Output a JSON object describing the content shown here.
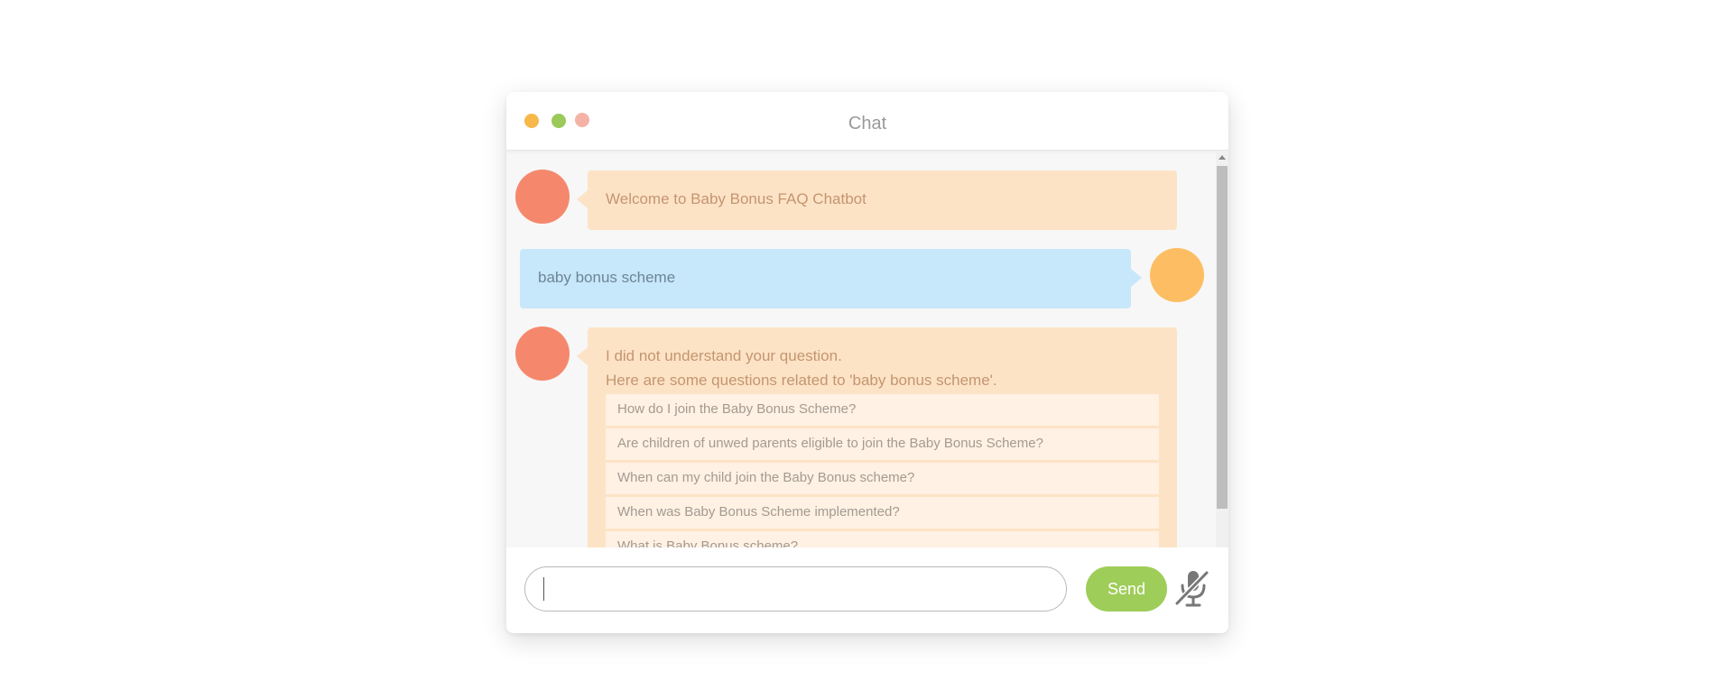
{
  "window": {
    "title": "Chat",
    "controls": [
      "minimize",
      "maximize",
      "close"
    ]
  },
  "messages": [
    {
      "sender": "bot",
      "lines": [
        "Welcome to Baby Bonus FAQ Chatbot"
      ]
    },
    {
      "sender": "user",
      "lines": [
        "baby bonus scheme"
      ]
    },
    {
      "sender": "bot",
      "lines": [
        "I did not understand your question.",
        "Here are some questions related to 'baby bonus scheme'."
      ],
      "suggestions": [
        "How do I join the Baby Bonus Scheme?",
        "Are children of unwed parents eligible to join the Baby Bonus Scheme?",
        "When can my child join the Baby Bonus scheme?",
        "When was Baby Bonus Scheme implemented?",
        "What is Baby Bonus scheme?"
      ]
    }
  ],
  "composer": {
    "value": "",
    "placeholder": "",
    "send_label": "Send",
    "mic_icon": "microphone-off-icon"
  },
  "colors": {
    "bot_avatar": "#f5886c",
    "user_avatar": "#fdbe63",
    "bot_bubble": "#fde3c6",
    "user_bubble": "#c7e8fa",
    "send_button": "#9fcd59",
    "dot_minimize": "#f7b84b",
    "dot_maximize": "#9bc95a",
    "dot_close": "#f4b3a6"
  }
}
